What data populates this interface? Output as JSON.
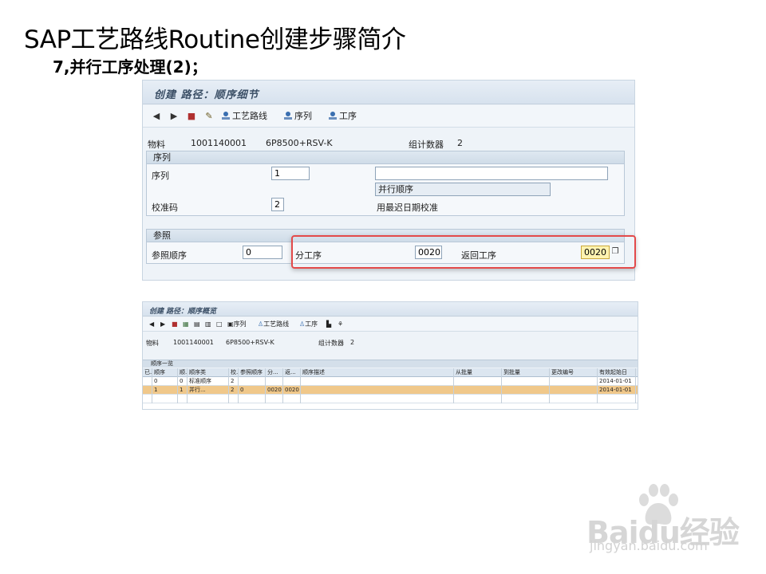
{
  "slide": {
    "title": "SAP工艺路线Routine创建步骤简介",
    "subtitle": "7,并行工序处理(2)；"
  },
  "screen1": {
    "title": "创建 路径：顺序细节",
    "toolbar": {
      "back_icon": "arrow-left-icon",
      "forward_icon": "arrow-right-icon",
      "routing_label": "工艺路线",
      "sequence_label": "序列",
      "operation_label": "工序"
    },
    "header": {
      "material_label": "物料",
      "material_value": "1001140001",
      "material_desc": "6P8500+RSV-K",
      "counter_label": "组计数器",
      "counter_value": "2"
    },
    "sequence_group": {
      "title": "序列",
      "sequence_label": "序列",
      "sequence_value": "1",
      "description_value": "",
      "parallel_label": "并行顺序",
      "alignment_label": "校准码",
      "alignment_value": "2",
      "alignment_text": "用最迟日期校准"
    },
    "reference_group": {
      "title": "参照",
      "ref_sequence_label": "参照顺序",
      "ref_sequence_value": "0",
      "branch_op_label": "分工序",
      "branch_op_value": "0020",
      "return_op_label": "返回工序",
      "return_op_value": "0020"
    },
    "highlight_color": "#e34a4a"
  },
  "screen2": {
    "title": "创建 路径：顺序概览",
    "toolbar": {
      "sequence_label": "序列",
      "routing_label": "工艺路线",
      "operation_label": "工序"
    },
    "header": {
      "material_label": "物料",
      "material_value": "1001140001",
      "material_desc": "6P8500+RSV-K",
      "counter_label": "组计数器",
      "counter_value": "2"
    },
    "section_title": "顺序一览",
    "columns": [
      "已..",
      "顺序",
      "顺..",
      "顺序类",
      "校..",
      "参照顺序",
      "分...",
      "返...",
      "顺序描述",
      "从批量",
      "到批量",
      "更改编号",
      "有效起始日"
    ],
    "rows": [
      [
        "",
        "0",
        "0",
        "标准顺序",
        "2",
        "",
        "",
        "",
        "",
        "",
        "",
        "",
        "2014-01-01"
      ],
      [
        "",
        "1",
        "1",
        "并行...",
        "2",
        "0",
        "0020",
        "0020",
        "",
        "",
        "",
        "",
        "2014-01-01"
      ],
      [
        "",
        "",
        "",
        "",
        "",
        "",
        "",
        "",
        "",
        "",
        "",
        "",
        ""
      ]
    ],
    "selected_row_color": "#f0c88a"
  },
  "watermark": {
    "logo": "Baidu经验",
    "url": "jingyan.baidu.com"
  }
}
